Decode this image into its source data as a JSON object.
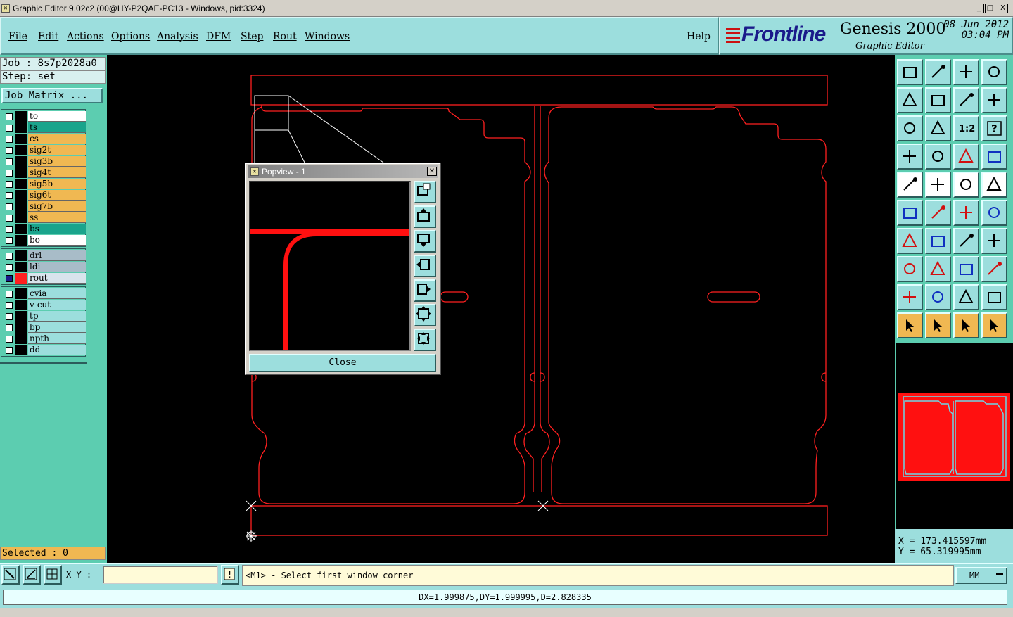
{
  "window": {
    "title": "Graphic Editor 9.02c2 (00@HY-P2QAE-PC13 - Windows, pid:3324)",
    "minimize": "_",
    "maximize": "□",
    "close": "X"
  },
  "menubar": {
    "items": [
      "File",
      "Edit",
      "Actions",
      "Options",
      "Analysis",
      "DFM",
      "Step",
      "Rout",
      "Windows"
    ],
    "help": "Help"
  },
  "brand": {
    "logo": "Frontline",
    "product": "Genesis 2000",
    "subtitle": "Graphic Editor",
    "date": "08 Jun 2012",
    "time": "03:04 PM"
  },
  "job": {
    "job_line": "Job : 8s7p2028a0",
    "step_line": "Step: set",
    "matrix_button": "Job Matrix ..."
  },
  "layers": {
    "group1": [
      {
        "name": "to",
        "color": "#ffffff"
      },
      {
        "name": "ts",
        "color": "#1aa48c"
      },
      {
        "name": "cs",
        "color": "#f0b852"
      },
      {
        "name": "sig2t",
        "color": "#f0b852"
      },
      {
        "name": "sig3b",
        "color": "#f0b852"
      },
      {
        "name": "sig4t",
        "color": "#f0b852"
      },
      {
        "name": "sig5b",
        "color": "#f0b852"
      },
      {
        "name": "sig6t",
        "color": "#f0b852"
      },
      {
        "name": "sig7b",
        "color": "#f0b852"
      },
      {
        "name": "ss",
        "color": "#f0b852"
      },
      {
        "name": "bs",
        "color": "#1aa48c"
      },
      {
        "name": "bo",
        "color": "#ffffff"
      }
    ],
    "group2": [
      {
        "name": "drl",
        "color": "#a8bcc8"
      },
      {
        "name": "ldi",
        "color": "#a8bcc8"
      },
      {
        "name": "rout",
        "color": "#d8e4ec",
        "active": true
      }
    ],
    "group3": [
      {
        "name": "cvia",
        "color": "#9cdedd"
      },
      {
        "name": "v-cut",
        "color": "#9cdedd"
      },
      {
        "name": "tp",
        "color": "#9cdedd"
      },
      {
        "name": "bp",
        "color": "#9cdedd"
      },
      {
        "name": "npth",
        "color": "#9cdedd"
      },
      {
        "name": "dd",
        "color": "#9cdedd"
      }
    ]
  },
  "selected": "Selected : 0",
  "popview": {
    "title": "Popview - 1",
    "close_label": "Close"
  },
  "coords": {
    "x": "X = 173.415597mm",
    "y": "Y = 65.319995mm"
  },
  "command": {
    "xy_label": "X Y :",
    "xy_value": "",
    "prompt": "<M1> - Select first window corner",
    "units": "MM"
  },
  "status": "DX=1.999875,DY=1.999995,D=2.828335",
  "colors": {
    "rout": "#ff2020",
    "panel": "#9cdedd",
    "left_panel": "#5ccdb0",
    "highlight": "#f0b852"
  }
}
